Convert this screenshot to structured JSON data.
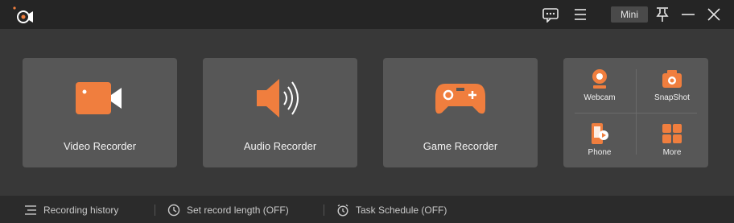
{
  "titlebar": {
    "mini_label": "Mini",
    "icons": [
      "app-logo-icon",
      "feedback-icon",
      "menu-icon",
      "pin-icon",
      "minimize-icon",
      "close-icon"
    ]
  },
  "cards": [
    {
      "label": "Video Recorder",
      "icon": "video-camera-icon"
    },
    {
      "label": "Audio Recorder",
      "icon": "speaker-icon"
    },
    {
      "label": "Game Recorder",
      "icon": "gamepad-icon"
    }
  ],
  "tools": [
    {
      "label": "Webcam",
      "icon": "webcam-icon"
    },
    {
      "label": "SnapShot",
      "icon": "camera-icon"
    },
    {
      "label": "Phone",
      "icon": "phone-icon"
    },
    {
      "label": "More",
      "icon": "grid-icon"
    }
  ],
  "statusbar": {
    "history_label": "Recording history",
    "length_label": "Set record length (OFF)",
    "schedule_label": "Task Schedule (OFF)"
  },
  "colors": {
    "accent": "#f07e3e",
    "titlebar": "#252525",
    "main_bg": "#383838",
    "card_bg": "#575757"
  }
}
